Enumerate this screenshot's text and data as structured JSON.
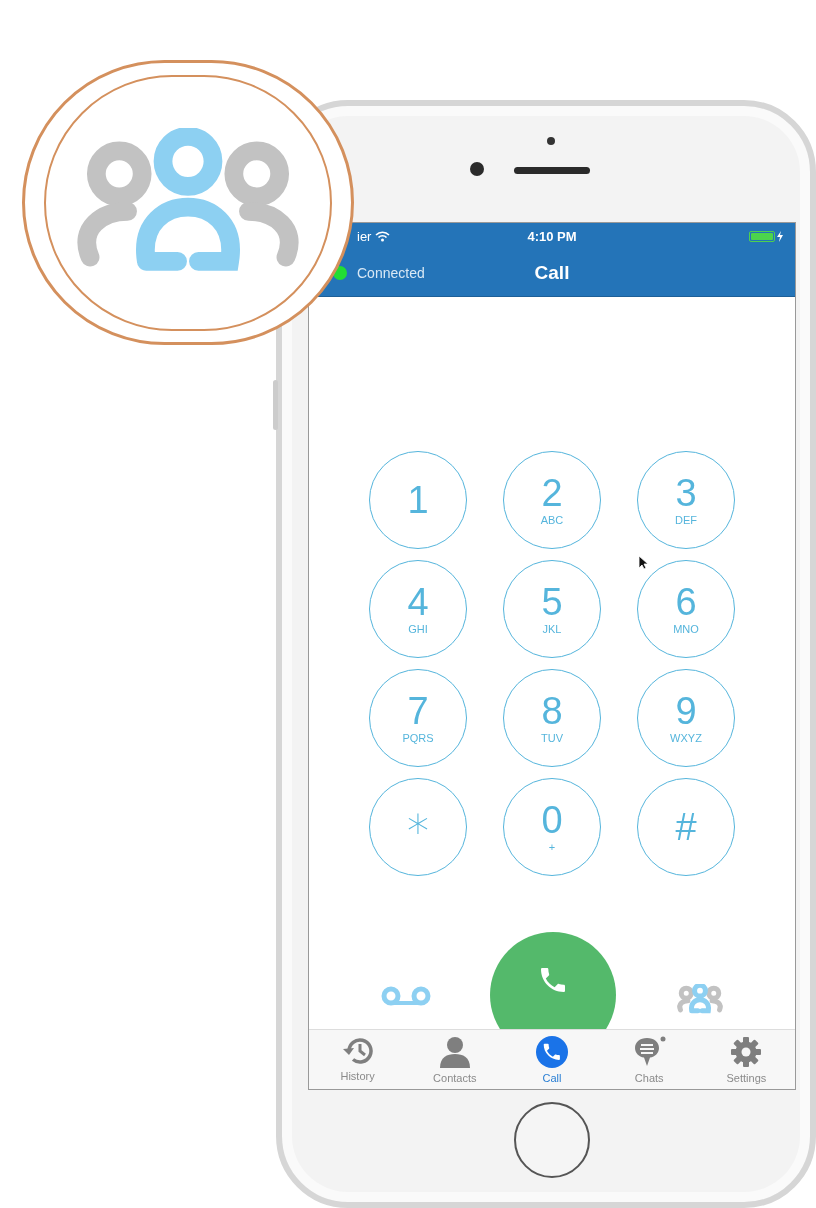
{
  "status_bar": {
    "carrier": "ier",
    "time": "4:10 PM"
  },
  "nav": {
    "status": {
      "text": "Connected",
      "color": "#22dd33"
    },
    "title": "Call"
  },
  "keypad": [
    {
      "digit": "1"
    },
    {
      "digit": "2",
      "letters": "ABC"
    },
    {
      "digit": "3",
      "letters": "DEF"
    },
    {
      "digit": "4",
      "letters": "GHI"
    },
    {
      "digit": "5",
      "letters": "JKL"
    },
    {
      "digit": "6",
      "letters": "MNO"
    },
    {
      "digit": "7",
      "letters": "PQRS"
    },
    {
      "digit": "8",
      "letters": "TUV"
    },
    {
      "digit": "9",
      "letters": "WXYZ"
    },
    {
      "digit": "*"
    },
    {
      "digit": "0",
      "letters": "+"
    },
    {
      "digit": "#"
    }
  ],
  "tabs": [
    {
      "kind": "history",
      "label": "History",
      "selected": false
    },
    {
      "kind": "contacts",
      "label": "Contacts",
      "selected": false
    },
    {
      "kind": "call",
      "label": "Call",
      "selected": true
    },
    {
      "kind": "chats",
      "label": "Chats",
      "selected": false,
      "unread": true
    },
    {
      "kind": "settings",
      "label": "Settings",
      "selected": false
    }
  ]
}
